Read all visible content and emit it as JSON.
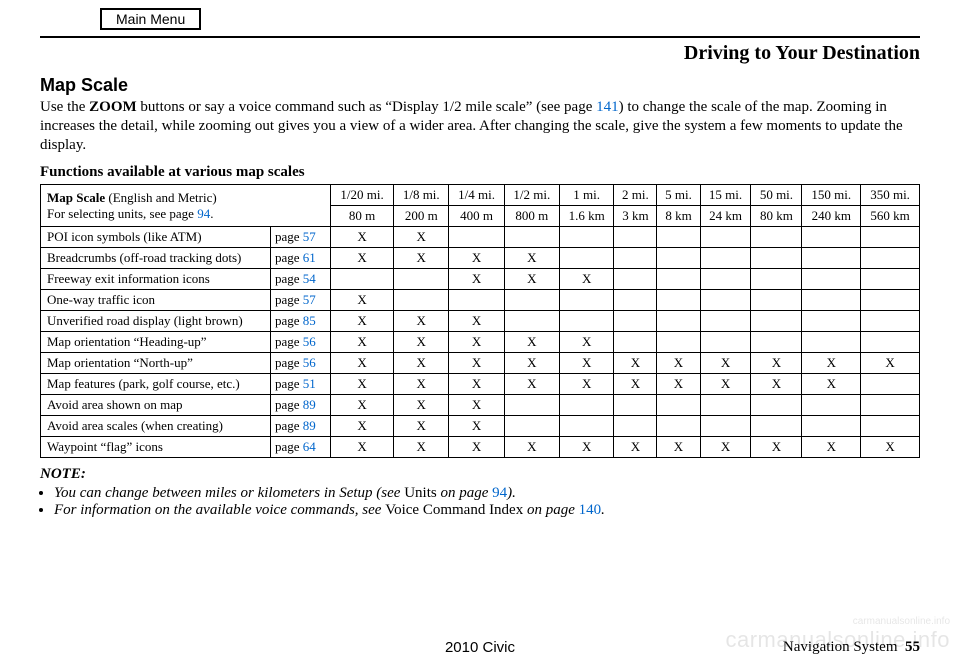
{
  "main_menu_label": "Main Menu",
  "chapter_title": "Driving to Your Destination",
  "section_title": "Map Scale",
  "intro": {
    "part1": "Use the ",
    "bold": "ZOOM",
    "part2": " buttons or say a voice command such as “Display 1/2 mile scale” (see page ",
    "link1": "141",
    "part3": ") to change the scale of the map. Zooming in increases the detail, while zooming out gives you a view of a wider area. After changing the scale, give the system a few moments to update the display."
  },
  "table_caption": "Functions available at various map scales",
  "table_header": {
    "label_line1_a": "Map Scale",
    "label_line1_b": " (English and Metric)",
    "label_line2_a": "For selecting units, see page ",
    "label_line2_link": "94",
    "label_line2_b": "."
  },
  "scales_mi": [
    "1/20 mi.",
    "1/8 mi.",
    "1/4 mi.",
    "1/2 mi.",
    "1 mi.",
    "2 mi.",
    "5 mi.",
    "15 mi.",
    "50 mi.",
    "150 mi.",
    "350 mi."
  ],
  "scales_km": [
    "80 m",
    "200 m",
    "400 m",
    "800 m",
    "1.6 km",
    "3 km",
    "8 km",
    "24 km",
    "80 km",
    "240 km",
    "560 km"
  ],
  "page_prefix": "page ",
  "rows": [
    {
      "feature": "POI icon symbols (like ATM)",
      "page": "57",
      "marks": [
        "X",
        "X",
        "",
        "",
        "",
        "",
        "",
        "",
        "",
        "",
        ""
      ]
    },
    {
      "feature": "Breadcrumbs (off-road tracking dots)",
      "page": "61",
      "marks": [
        "X",
        "X",
        "X",
        "X",
        "",
        "",
        "",
        "",
        "",
        "",
        ""
      ]
    },
    {
      "feature": "Freeway exit information icons",
      "page": "54",
      "marks": [
        "",
        "",
        "X",
        "X",
        "X",
        "",
        "",
        "",
        "",
        "",
        ""
      ]
    },
    {
      "feature": "One-way traffic icon",
      "page": "57",
      "marks": [
        "X",
        "",
        "",
        "",
        "",
        "",
        "",
        "",
        "",
        "",
        ""
      ]
    },
    {
      "feature": "Unverified road display (light brown)",
      "page": "85",
      "marks": [
        "X",
        "X",
        "X",
        "",
        "",
        "",
        "",
        "",
        "",
        "",
        ""
      ]
    },
    {
      "feature": "Map orientation “Heading-up”",
      "page": "56",
      "marks": [
        "X",
        "X",
        "X",
        "X",
        "X",
        "",
        "",
        "",
        "",
        "",
        ""
      ]
    },
    {
      "feature": "Map orientation “North-up”",
      "page": "56",
      "marks": [
        "X",
        "X",
        "X",
        "X",
        "X",
        "X",
        "X",
        "X",
        "X",
        "X",
        "X"
      ]
    },
    {
      "feature": "Map features (park, golf course, etc.)",
      "page": "51",
      "marks": [
        "X",
        "X",
        "X",
        "X",
        "X",
        "X",
        "X",
        "X",
        "X",
        "X",
        ""
      ]
    },
    {
      "feature": "Avoid area shown on map",
      "page": "89",
      "marks": [
        "X",
        "X",
        "X",
        "",
        "",
        "",
        "",
        "",
        "",
        "",
        ""
      ]
    },
    {
      "feature": "Avoid area scales (when creating)",
      "page": "89",
      "marks": [
        "X",
        "X",
        "X",
        "",
        "",
        "",
        "",
        "",
        "",
        "",
        ""
      ]
    },
    {
      "feature": "Waypoint “flag” icons",
      "page": "64",
      "marks": [
        "X",
        "X",
        "X",
        "X",
        "X",
        "X",
        "X",
        "X",
        "X",
        "X",
        "X"
      ]
    }
  ],
  "note_head": "NOTE:",
  "notes": [
    {
      "italic1": "You can change between miles or kilometers in Setup (see ",
      "roman": "Units",
      "italic2": " on page ",
      "link": "94",
      "italic3": ")."
    },
    {
      "italic1": "For information on the available voice commands, see ",
      "roman": "Voice Command Index",
      "italic2": " on page ",
      "link": "140",
      "italic3": "."
    }
  ],
  "footer": {
    "center": "2010 Civic",
    "right_label": "Navigation System",
    "right_page": "55"
  },
  "watermark": "carmanualsonline.info"
}
